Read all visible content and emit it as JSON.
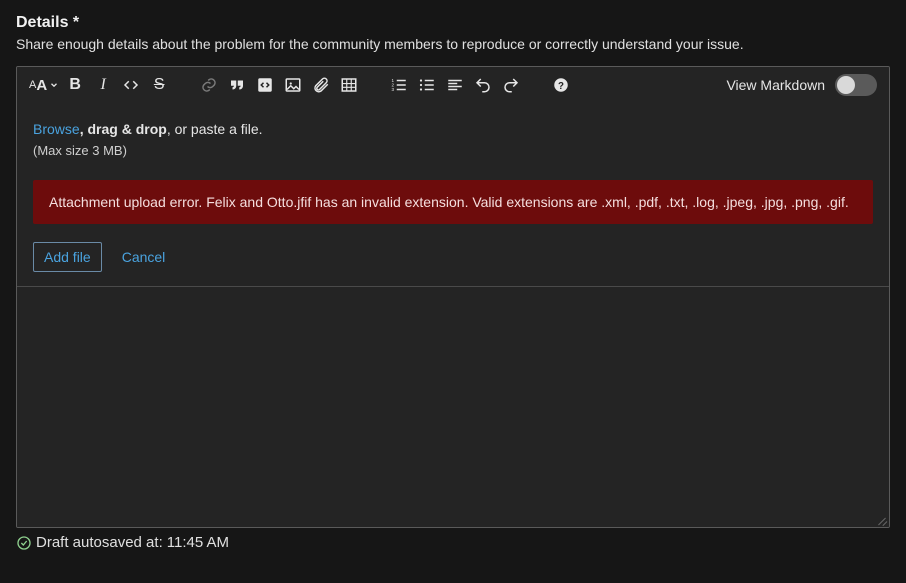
{
  "heading": "Details *",
  "subhead": "Share enough details about the problem for the community members to reproduce or correctly understand your issue.",
  "toolbar": {
    "font_size": "AA",
    "bold": "B",
    "italic": "I",
    "strike": "S",
    "view_markdown": "View Markdown"
  },
  "attach": {
    "browse": "Browse",
    "drag_drop": ", drag & drop",
    "or_paste": ", or paste a file.",
    "max_size": "(Max size 3 MB)",
    "error": "Attachment upload error. Felix and Otto.jfif has an invalid extension. Valid extensions are .xml, .pdf, .txt, .log, .jpeg, .jpg, .png, .gif.",
    "add_file": "Add file",
    "cancel": "Cancel"
  },
  "autosave": {
    "prefix": "Draft autosaved at: ",
    "time": "11:45 AM"
  }
}
